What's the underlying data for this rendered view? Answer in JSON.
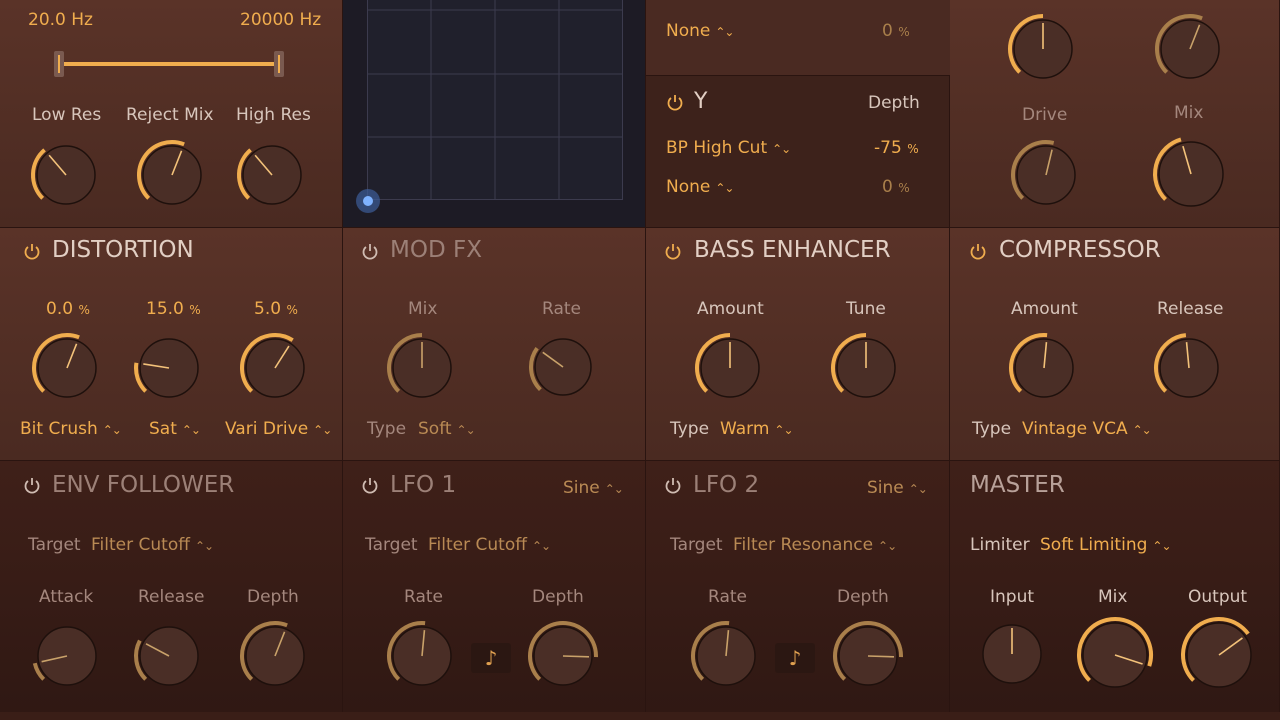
{
  "filter": {
    "low_freq": "20.0 Hz",
    "high_freq": "20000 Hz",
    "knobs": [
      {
        "label": "Low Res",
        "value": 0.35
      },
      {
        "label": "Reject Mix",
        "value": 0.58
      },
      {
        "label": "High Res",
        "value": 0.35
      }
    ]
  },
  "modmatrix": {
    "x_row": {
      "target": "None",
      "depth": "0",
      "unit": "%"
    },
    "y_title": "Y",
    "depth_label": "Depth",
    "y_rows": [
      {
        "target": "BP High Cut",
        "depth": "-75",
        "unit": "%"
      },
      {
        "target": "None",
        "depth": "0",
        "unit": "%"
      }
    ]
  },
  "saturation": {
    "drive_label": "Drive",
    "mix_label": "Mix",
    "knobs_top": [
      0.5,
      0.58
    ],
    "knobs_bottom": [
      0.55,
      0.44
    ]
  },
  "distortion": {
    "title": "DISTORTION",
    "items": [
      {
        "value": "0.0",
        "unit": "%",
        "type": "Bit Crush",
        "level": 0.58
      },
      {
        "value": "15.0",
        "unit": "%",
        "type": "Sat",
        "level": 0.2
      },
      {
        "value": "5.0",
        "unit": "%",
        "type": "Vari Drive",
        "level": 0.62
      }
    ]
  },
  "modfx": {
    "title": "MOD FX",
    "mix_label": "Mix",
    "rate_label": "Rate",
    "type_label": "Type",
    "type_value": "Soft",
    "mix_level": 0.5,
    "rate_level": 0.3
  },
  "bass": {
    "title": "BASS ENHANCER",
    "amount_label": "Amount",
    "tune_label": "Tune",
    "type_label": "Type",
    "type_value": "Warm",
    "amount_level": 0.5,
    "tune_level": 0.5
  },
  "compressor": {
    "title": "COMPRESSOR",
    "amount_label": "Amount",
    "release_label": "Release",
    "type_label": "Type",
    "type_value": "Vintage VCA",
    "amount_level": 0.52,
    "release_level": 0.48
  },
  "env": {
    "title": "ENV FOLLOWER",
    "target_label": "Target",
    "target_value": "Filter Cutoff",
    "knobs": [
      {
        "label": "Attack",
        "value": 0.12
      },
      {
        "label": "Release",
        "value": 0.27
      },
      {
        "label": "Depth",
        "value": 0.58
      }
    ]
  },
  "lfo1": {
    "title": "LFO 1",
    "wave": "Sine",
    "target_label": "Target",
    "target_value": "Filter Cutoff",
    "rate_label": "Rate",
    "depth_label": "Depth",
    "rate_level": 0.52,
    "depth_level": 0.84,
    "note_glyph": "♪"
  },
  "lfo2": {
    "title": "LFO 2",
    "wave": "Sine",
    "target_label": "Target",
    "target_value": "Filter Resonance",
    "rate_label": "Rate",
    "depth_label": "Depth",
    "rate_level": 0.52,
    "depth_level": 0.84,
    "note_glyph": "♪"
  },
  "master": {
    "title": "MASTER",
    "limiter_label": "Limiter",
    "limiter_value": "Soft Limiting",
    "input_label": "Input",
    "mix_label": "Mix",
    "output_label": "Output",
    "input_level": 0.5,
    "mix_level": 0.9,
    "output_level": 0.7
  },
  "colors": {
    "accent": "#f0ad4e",
    "accent_dim": "#a97f4b",
    "knob_body": "#4a2e26",
    "track": "#2a1814"
  }
}
